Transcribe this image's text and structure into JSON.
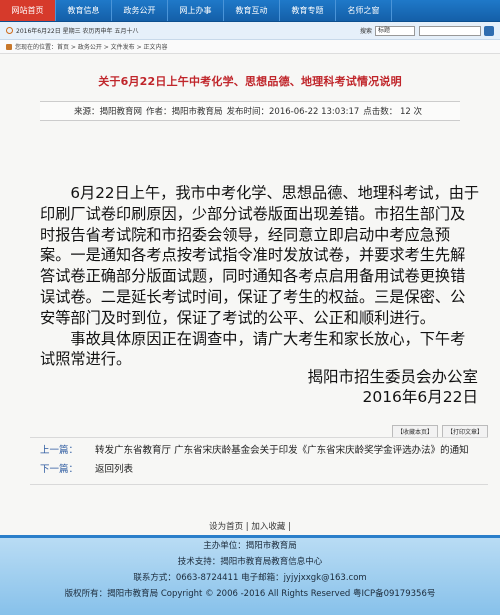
{
  "nav": {
    "items": [
      "网站首页",
      "教育信息",
      "政务公开",
      "网上办事",
      "教育互动",
      "教育专题",
      "名师之窗"
    ]
  },
  "datebar": {
    "date_text": "2016年6月22日 星期三 农历丙申年 五月十八",
    "search_label": "搜索",
    "search_select": "标题",
    "search_placeholder": ""
  },
  "breadcrumb": {
    "text": "您现在的位置：首页 > 政务公开 > 文件发布 > 正文内容"
  },
  "article": {
    "title": "关于6月22日上午中考化学、思想品德、地理科考试情况说明",
    "meta": {
      "source": "来源：揭阳教育网",
      "author": "作者：揭阳市教育局",
      "time": "发布时间：2016-06-22 13:03:17",
      "clicks": "点击数：  12 次"
    },
    "paragraphs": [
      "6月22日上午，我市中考化学、思想品德、地理科考试，由于印刷厂试卷印刷原因，少部分试卷版面出现差错。市招生部门及时报告省考试院和市招委会领导，经同意立即启动中考应急预案。一是通知各考点按考试指令准时发放试卷，并要求考生先解答试卷正确部分版面试题，同时通知各考点启用备用试卷更换错误试卷。二是延长考试时间，保证了考生的权益。三是保密、公安等部门及时到位，保证了考试的公平、公正和顺利进行。",
      "事故具体原因正在调查中，请广大考生和家长放心，下午考试照常进行。"
    ],
    "signature": "揭阳市招生委员会办公室",
    "sign_date": "2016年6月22日",
    "actions": [
      "【收藏本页】",
      "【打印文章】"
    ]
  },
  "related": {
    "prev_label": "上一篇：",
    "prev_text": "转发广东省教育厅 广东省宋庆龄基金会关于印发《广东省宋庆龄奖学金评选办法》的通知",
    "next_label": "下一篇：",
    "next_text": "返回列表"
  },
  "footer": {
    "links": "设为首页 | 加入收藏 |",
    "host": "主办单位：揭阳市教育局",
    "support": "技术支持：揭阳市教育局教育信息中心",
    "contact": "联系方式：0663-8724411 电子邮箱：jyjyjxxgk@163.com",
    "copyright": "版权所有：揭阳市教育局 Copyright © 2006 -2016 All Rights Reserved 粤ICP备09179356号"
  },
  "colors": {
    "nav_bg": "#1a6cbb",
    "nav_active": "#d63a2b",
    "title_red": "#c0262b",
    "footer_blue": "#9fd0f0"
  }
}
